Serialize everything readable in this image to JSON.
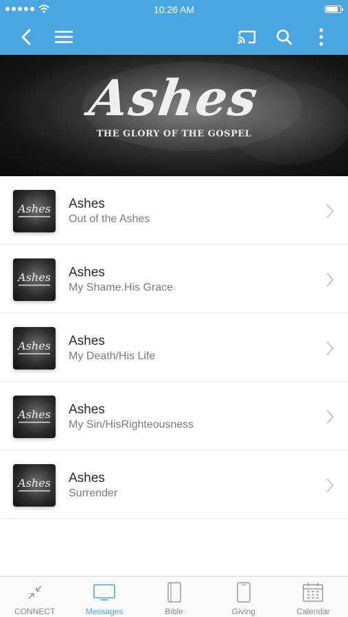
{
  "status_bar": {
    "time": "10:26 AM"
  },
  "colors": {
    "accent": "#4aa6e0",
    "tab_inactive": "#8a8a8a"
  },
  "nav": {
    "icons": [
      "back-icon",
      "menu-icon",
      "cast-icon",
      "search-icon",
      "more-vertical-icon"
    ]
  },
  "hero": {
    "logo_text": "Ashes",
    "subtitle": "THE GLORY OF THE GOSPEL"
  },
  "messages": [
    {
      "title": "Ashes",
      "subtitle": "Out of the Ashes"
    },
    {
      "title": "Ashes",
      "subtitle": "My Shame.His Grace"
    },
    {
      "title": "Ashes",
      "subtitle": "My Death/His Life"
    },
    {
      "title": "Ashes",
      "subtitle": "My Sin/HisRighteousness"
    },
    {
      "title": "Ashes",
      "subtitle": "Surrender"
    }
  ],
  "tabs": [
    {
      "label": "CONNECT",
      "icon": "connect-icon",
      "active": false
    },
    {
      "label": "Messages",
      "icon": "monitor-icon",
      "active": true
    },
    {
      "label": "Bible",
      "icon": "book-icon",
      "active": false
    },
    {
      "label": "Giving",
      "icon": "phone-icon",
      "active": false
    },
    {
      "label": "Calendar",
      "icon": "calendar-icon",
      "active": false
    }
  ]
}
